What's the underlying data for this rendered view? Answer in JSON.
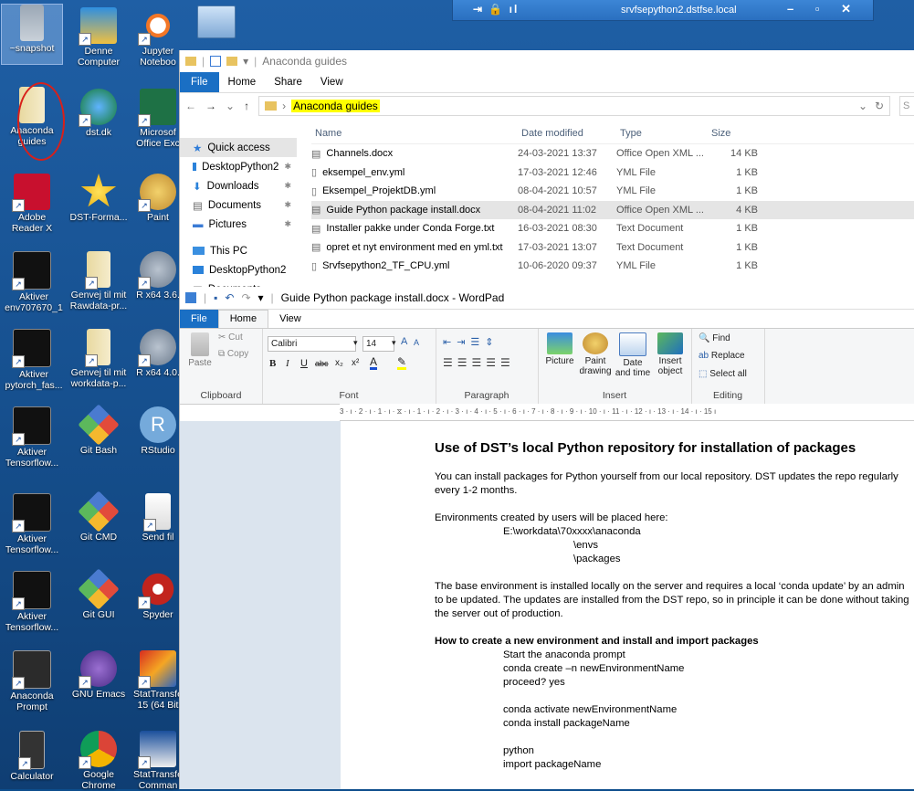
{
  "rdp_bar": {
    "host": "srvfsepython2.dstfse.local"
  },
  "desktop": {
    "icons": [
      {
        "label": "~snapshot"
      },
      {
        "label": "Denne Computer"
      },
      {
        "label": "Jupyter Noteboo"
      },
      {
        "label": "Anaconda guides"
      },
      {
        "label": "dst.dk"
      },
      {
        "label": "Microsof Office Exc"
      },
      {
        "label": "Adobe Reader X"
      },
      {
        "label": "DST-Forma..."
      },
      {
        "label": "Paint"
      },
      {
        "label": "Aktiver env707670_1"
      },
      {
        "label": "Genvej til mit Rawdata-pr..."
      },
      {
        "label": "R x64 3.6."
      },
      {
        "label": "Aktiver pytorch_fas..."
      },
      {
        "label": "Genvej til mit workdata-p..."
      },
      {
        "label": "R x64 4.0."
      },
      {
        "label": "Aktiver Tensorflow..."
      },
      {
        "label": "Git Bash"
      },
      {
        "label": "RStudio"
      },
      {
        "label": "Aktiver Tensorflow..."
      },
      {
        "label": "Git CMD"
      },
      {
        "label": "Send fil"
      },
      {
        "label": "Aktiver Tensorflow..."
      },
      {
        "label": "Git GUI"
      },
      {
        "label": "Spyder"
      },
      {
        "label": "Anaconda Prompt"
      },
      {
        "label": "GNU Emacs"
      },
      {
        "label": "StatTransfe 15 (64 Bit"
      },
      {
        "label": "Calculator"
      },
      {
        "label": "Google Chrome"
      },
      {
        "label": "StatTransfe Comman"
      }
    ]
  },
  "explorer": {
    "title": "Anaconda guides",
    "tabs": [
      "File",
      "Home",
      "Share",
      "View"
    ],
    "breadcrumb": "Anaconda guides",
    "search_placeholder": "S",
    "nav": [
      {
        "label": "Quick access",
        "pinned": false
      },
      {
        "label": "DesktopPython2",
        "pinned": true
      },
      {
        "label": "Downloads",
        "pinned": true
      },
      {
        "label": "Documents",
        "pinned": true
      },
      {
        "label": "Pictures",
        "pinned": true
      },
      {
        "label": "This PC",
        "pinned": false
      },
      {
        "label": "DesktopPython2",
        "pinned": false
      },
      {
        "label": "Documents",
        "pinned": false
      }
    ],
    "columns": [
      "Name",
      "Date modified",
      "Type",
      "Size"
    ],
    "files": [
      {
        "name": "Channels.docx",
        "date": "24-03-2021 13:37",
        "type": "Office Open XML ...",
        "size": "14 KB"
      },
      {
        "name": "eksempel_env.yml",
        "date": "17-03-2021 12:46",
        "type": "YML File",
        "size": "1 KB"
      },
      {
        "name": "Eksempel_ProjektDB.yml",
        "date": "08-04-2021 10:57",
        "type": "YML File",
        "size": "1 KB"
      },
      {
        "name": "Guide Python package install.docx",
        "date": "08-04-2021 11:02",
        "type": "Office Open XML ...",
        "size": "4 KB"
      },
      {
        "name": "Installer pakke under Conda Forge.txt",
        "date": "16-03-2021 08:30",
        "type": "Text Document",
        "size": "1 KB"
      },
      {
        "name": "opret et nyt environment med en yml.txt",
        "date": "17-03-2021 13:07",
        "type": "Text Document",
        "size": "1 KB"
      },
      {
        "name": "Srvfsepython2_TF_CPU.yml",
        "date": "10-06-2020 09:37",
        "type": "YML File",
        "size": "1 KB"
      }
    ]
  },
  "wordpad": {
    "title": "Guide Python package install.docx - WordPad",
    "tabs": [
      "File",
      "Home",
      "View"
    ],
    "clipboard": {
      "paste": "Paste",
      "cut": "Cut",
      "copy": "Copy",
      "label": "Clipboard"
    },
    "font": {
      "family": "Calibri",
      "size": "14",
      "label": "Font"
    },
    "paragraph_label": "Paragraph",
    "insert": {
      "picture": "Picture",
      "paint": "Paint drawing",
      "datetime": "Date and time",
      "object": "Insert object",
      "label": "Insert"
    },
    "editing": {
      "find": "Find",
      "replace": "Replace",
      "selectall": "Select all",
      "label": "Editing"
    },
    "ruler": "3 · ı · 2 · ı · 1 · ı · ⧖ · ı · 1 · ı · 2 · ı · 3 · ı · 4 · ı · 5 · ı · 6 · ı · 7 · ı · 8 · ı · 9 · ı · 10 · ı · 11 · ı · 12 · ı · 13 · ı · 14 · ı · 15 ı",
    "doc": {
      "heading": "Use of DST’s local Python repository for installation of packages",
      "p1": "You can install packages for Python yourself from our local repository. DST updates the repo regularly every 1-2 months.",
      "p2": "Environments created by users will be placed here:",
      "path1": "E:\\workdata\\70xxxx\\anaconda",
      "path2": "\\envs",
      "path3": "\\packages",
      "p3": "The base environment is installed locally on the server and requires a local ‘conda update’ by an admin to be updated. The updates are installed from the DST repo, so in principle it can be done without taking the server out of production.",
      "sub": "How to create a new environment and install and import packages",
      "s1": "Start the anaconda prompt",
      "s2": "conda create –n newEnvironmentName",
      "s3": "proceed? yes",
      "s4": "conda activate newEnvironmentName",
      "s5": "conda install packageName",
      "s6": "python",
      "s7": "import packageName"
    }
  }
}
